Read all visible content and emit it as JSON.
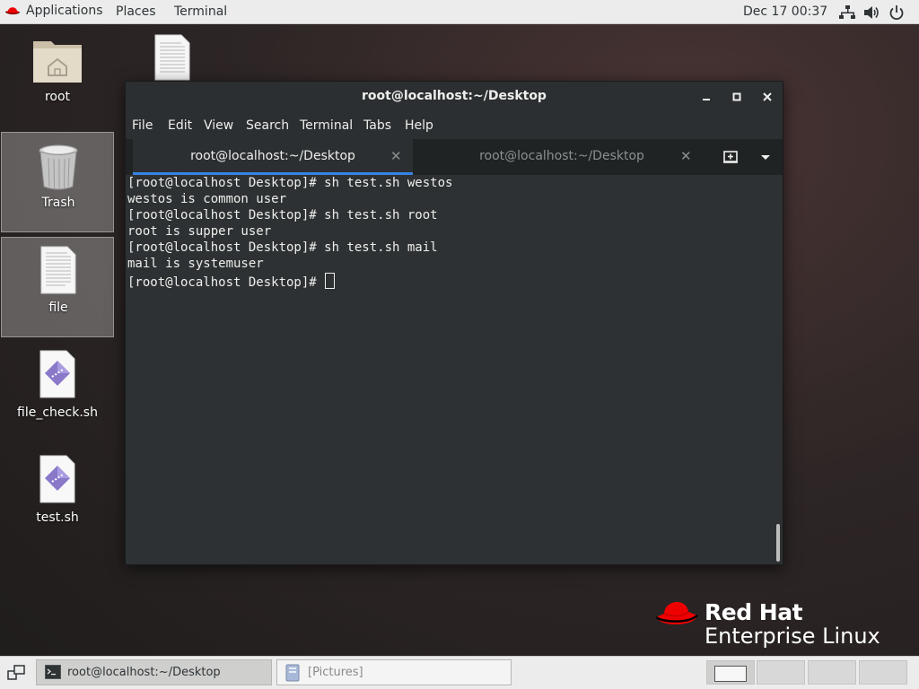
{
  "topbar": {
    "applications": "Applications",
    "places": "Places",
    "terminal": "Terminal",
    "clock": "Dec 17  00:37"
  },
  "desktop_icons": [
    {
      "label": "root"
    },
    {
      "label": "Trash"
    },
    {
      "label": "file"
    },
    {
      "label": "file_check.sh"
    },
    {
      "label": "test.sh"
    }
  ],
  "window": {
    "title": "root@localhost:~/Desktop",
    "menu": [
      "File",
      "Edit",
      "View",
      "Search",
      "Terminal",
      "Tabs",
      "Help"
    ],
    "tabs": [
      {
        "label": "root@localhost:~/Desktop",
        "active": true
      },
      {
        "label": "root@localhost:~/Desktop",
        "active": false
      }
    ],
    "terminal_lines": [
      "[root@localhost Desktop]# sh test.sh westos",
      "westos is common user",
      "[root@localhost Desktop]# sh test.sh root",
      "root is supper user",
      "[root@localhost Desktop]# sh test.sh mail",
      "mail is systemuser",
      "[root@localhost Desktop]# "
    ]
  },
  "branding": {
    "line1": "Red Hat",
    "line2": "Enterprise Linux"
  },
  "taskbar": {
    "tasks": [
      {
        "label": "root@localhost:~/Desktop",
        "active": true
      },
      {
        "label": "[Pictures]",
        "active": false
      }
    ]
  },
  "colors": {
    "accent": "#3584e4",
    "redhat_red": "#ee0000",
    "terminal_bg": "#2d3133"
  }
}
